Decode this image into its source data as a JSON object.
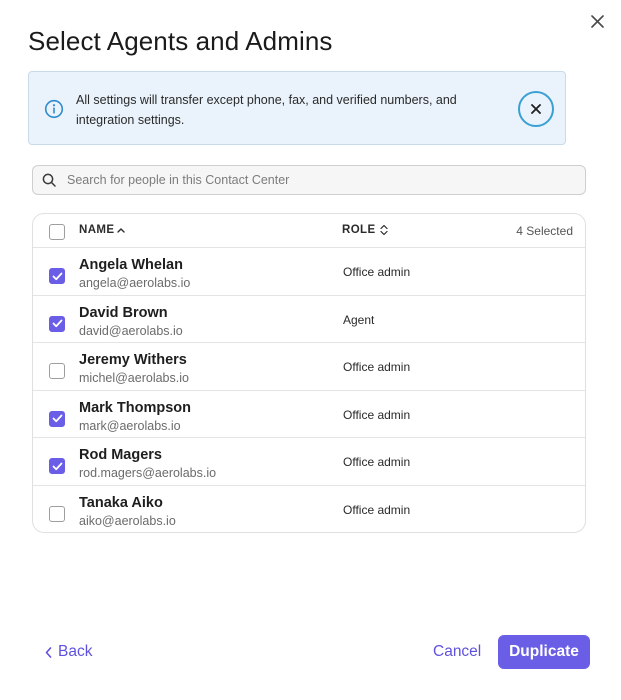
{
  "dialog": {
    "title": "Select Agents and Admins",
    "close_icon": "close-icon"
  },
  "banner": {
    "icon": "info-icon",
    "text": "All settings will transfer except phone, fax, and verified numbers, and integration settings.",
    "dismiss_icon": "close-icon",
    "accent_color": "#3aa0d4"
  },
  "search": {
    "placeholder": "Search for people in this Contact Center",
    "value": ""
  },
  "table": {
    "header": {
      "name_label": "NAME",
      "name_sort_icon": "sort-ascending-icon",
      "role_label": "ROLE",
      "role_sort_icon": "sort-icon",
      "selected_count": "4 Selected",
      "select_all_checked": false
    },
    "rows": [
      {
        "name": "Angela Whelan",
        "email": "angela@aerolabs.io",
        "role": "Office admin",
        "checked": true
      },
      {
        "name": "David Brown",
        "email": "david@aerolabs.io",
        "role": "Agent",
        "checked": true
      },
      {
        "name": "Jeremy Withers",
        "email": "michel@aerolabs.io",
        "role": "Office admin",
        "checked": false
      },
      {
        "name": "Mark Thompson",
        "email": "mark@aerolabs.io",
        "role": "Office admin",
        "checked": true
      },
      {
        "name": "Rod Magers",
        "email": "rod.magers@aerolabs.io",
        "role": "Office admin",
        "checked": true
      },
      {
        "name": "Tanaka Aiko",
        "email": "aiko@aerolabs.io",
        "role": "Office admin",
        "checked": false
      }
    ]
  },
  "footer": {
    "back_label": "Back",
    "back_icon": "chevron-left-icon",
    "cancel_label": "Cancel",
    "duplicate_label": "Duplicate"
  },
  "colors": {
    "primary": "#6a5ee6",
    "link": "#5f52de",
    "banner_bg": "#eaf3fb"
  }
}
